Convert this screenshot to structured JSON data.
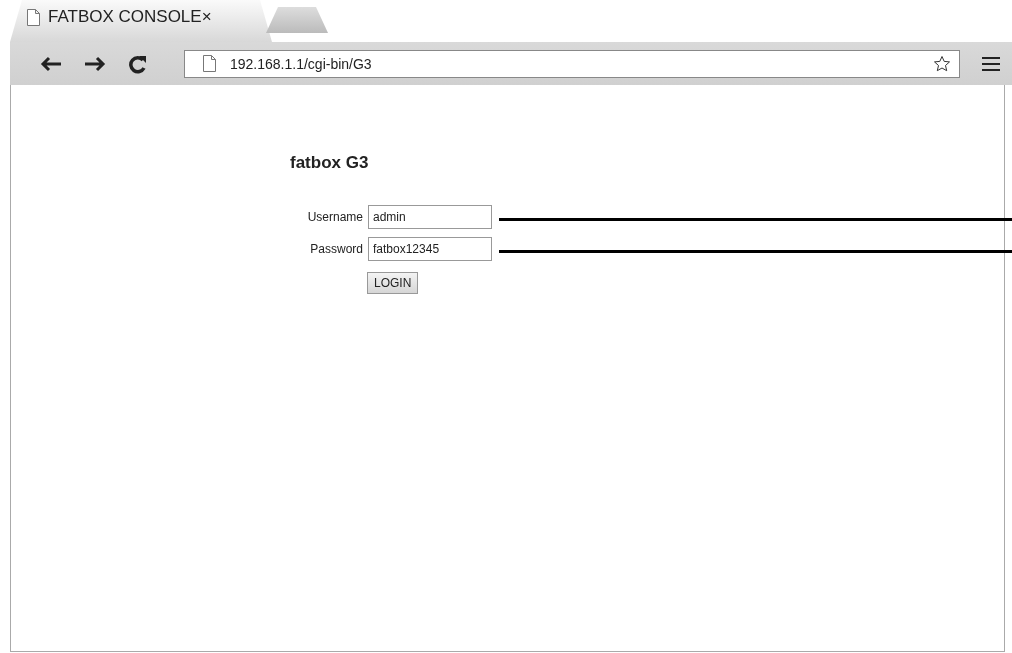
{
  "browser": {
    "tabs": [
      {
        "title": "FATBOX CONSOLE",
        "close": "×",
        "selected": true
      },
      {
        "selected": false
      }
    ],
    "address": "192.168.1.1/cgi-bin/G3"
  },
  "page": {
    "heading": "fatbox G3",
    "fields": [
      {
        "label": "Username",
        "value": "admin"
      },
      {
        "label": "Password",
        "value": "fatbox12345"
      }
    ],
    "button": "LOGIN"
  }
}
